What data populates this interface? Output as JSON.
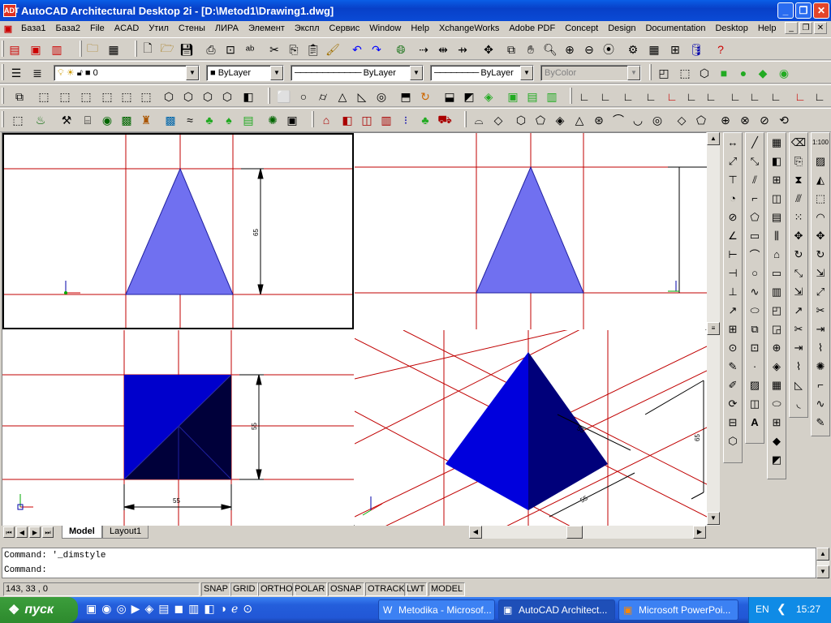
{
  "window": {
    "title": "AutoCAD Architectural Desktop 2i - [D:\\Metod1\\Drawing1.dwg]",
    "app_icon": "ADT"
  },
  "menu": [
    "База1",
    "База2",
    "File",
    "ACAD",
    "Утил",
    "Стены",
    "ЛИРА",
    "Элемент",
    "Экспл",
    "Сервис",
    "Window",
    "Help",
    "XchangeWorks",
    "Adobe PDF",
    "Concept",
    "Design",
    "Documentation",
    "Desktop",
    "Help"
  ],
  "layers": {
    "current_layer": "0",
    "color": "ByLayer",
    "linetype": "ByLayer",
    "lineweight": "ByLayer",
    "plotstyle": "ByColor"
  },
  "tabs": {
    "model": "Model",
    "layout": "Layout1"
  },
  "dimensions": {
    "top_height": "65",
    "side_height": "55",
    "bottom_width": "55",
    "iso_a": "55",
    "iso_b": "55",
    "iso_c": "65"
  },
  "command": {
    "line1": "Command:  '_dimstyle",
    "line2": "Command:"
  },
  "status": {
    "coords": "143, 33 , 0",
    "buttons": [
      "SNAP",
      "GRID",
      "ORTHO",
      "POLAR",
      "OSNAP",
      "OTRACK",
      "LWT",
      "MODEL"
    ]
  },
  "taskbar": {
    "start": "пуск",
    "tasks": [
      "Metodika - Microsof...",
      "AutoCAD Architect...",
      "Microsoft PowerPoi..."
    ],
    "lang": "EN",
    "clock": "15:27"
  },
  "colors": {
    "title": "#0a5ee6",
    "shape_light": "#7070f0",
    "shape_dark": "#0000cc",
    "shape_navy": "#00007a",
    "grid_red": "#c00000"
  }
}
